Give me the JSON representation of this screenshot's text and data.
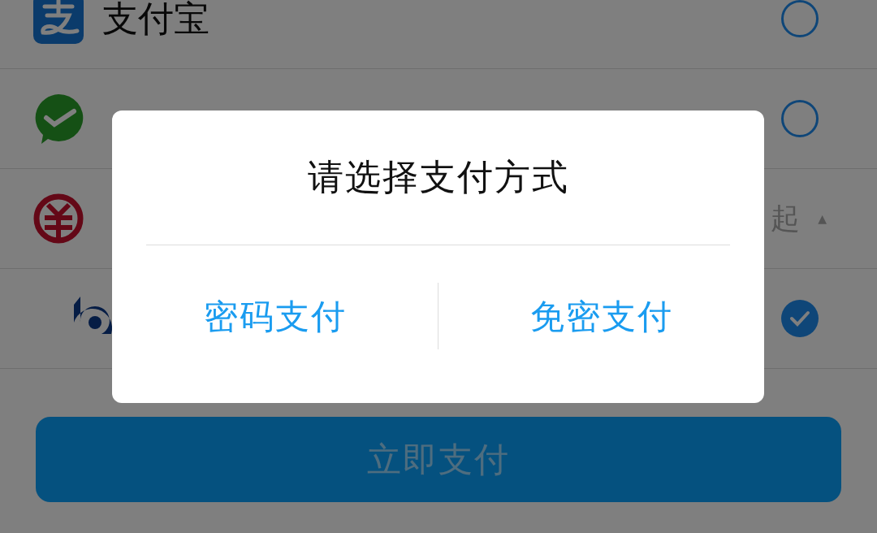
{
  "payment_methods": [
    {
      "kind": "alipay",
      "name": "支付宝",
      "selected": false
    },
    {
      "kind": "wechat",
      "selected": false
    },
    {
      "kind": "ecny",
      "toggle_label": "起",
      "toggle_arrow": "▲"
    },
    {
      "kind": "bank",
      "selected": true
    }
  ],
  "pay_button": {
    "label": "立即支付"
  },
  "dialog": {
    "title": "请选择支付方式",
    "options": [
      {
        "label": "密码支付"
      },
      {
        "label": "免密支付"
      }
    ]
  }
}
